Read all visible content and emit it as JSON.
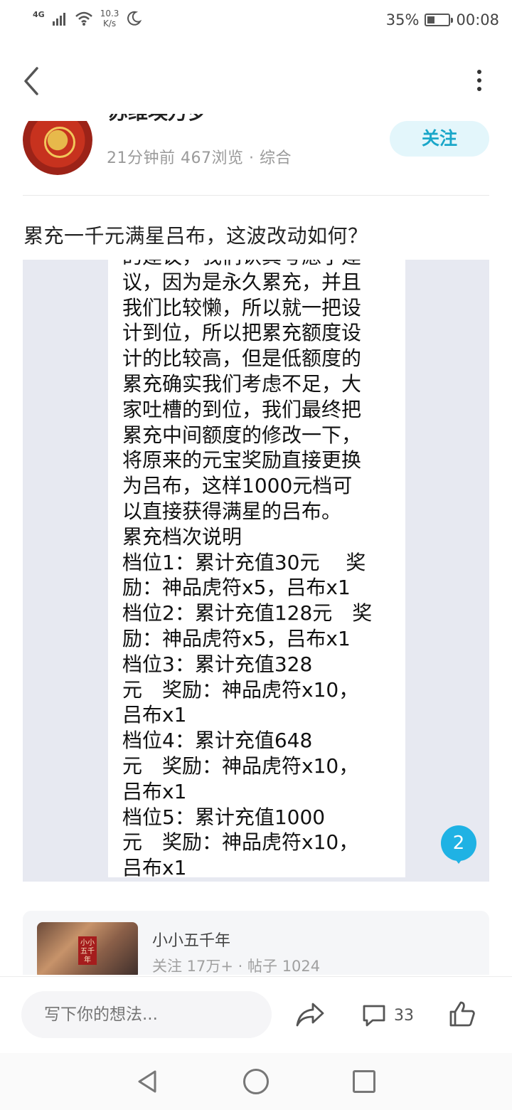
{
  "status_bar": {
    "network": "4G",
    "speed_value": "10.3",
    "speed_unit": "K/s",
    "battery": "35%",
    "battery_level": 0.35,
    "time": "00:08"
  },
  "author": {
    "name": "苏维埃万岁",
    "meta": "21分钟前 467浏览 · 综合",
    "follow_label": "关注"
  },
  "post": {
    "title": "累充一千元满星吕布，这波改动如何？",
    "image_text_lines": [
      "的建议，我们认真考虑了建",
      "议，因为是永久累充，并且",
      "我们比较懒，所以就一把设",
      "计到位，所以把累充额度设",
      "计的比较高，但是低额度的",
      "累充确实我们考虑不足，大",
      "家吐槽的到位，我们最终把",
      "累充中间额度的修改一下，",
      "将原来的元宝奖励直接更换",
      "为吕布，这样1000元档可",
      "以直接获得满星的吕布。",
      "累充档次说明",
      "档位1：累计充值30元　 奖",
      "励：神品虎符x5，吕布x1",
      "档位2：累计充值128元　奖",
      "励：神品虎符x5，吕布x1",
      "档位3：累计充值328",
      "元　奖励：神品虎符x10，",
      "吕布x1",
      "档位4：累计充值648",
      "元　奖励：神品虎符x10，",
      "吕布x1",
      "档位5：累计充值1000",
      "元　奖励：神品虎符x10，",
      "吕布x1"
    ],
    "image_badge": "2"
  },
  "topic": {
    "name": "小小五千年",
    "meta": "关注 17万+ · 帖子 1024",
    "thumb_text": "小小五千年"
  },
  "action_bar": {
    "comment_placeholder": "写下你的想法...",
    "comment_count": "33"
  },
  "colors": {
    "accent": "#1aa7c9",
    "follow_bg": "#e3f6fb",
    "badge": "#1fb2e4",
    "panel_bg": "#e7e9f1"
  }
}
